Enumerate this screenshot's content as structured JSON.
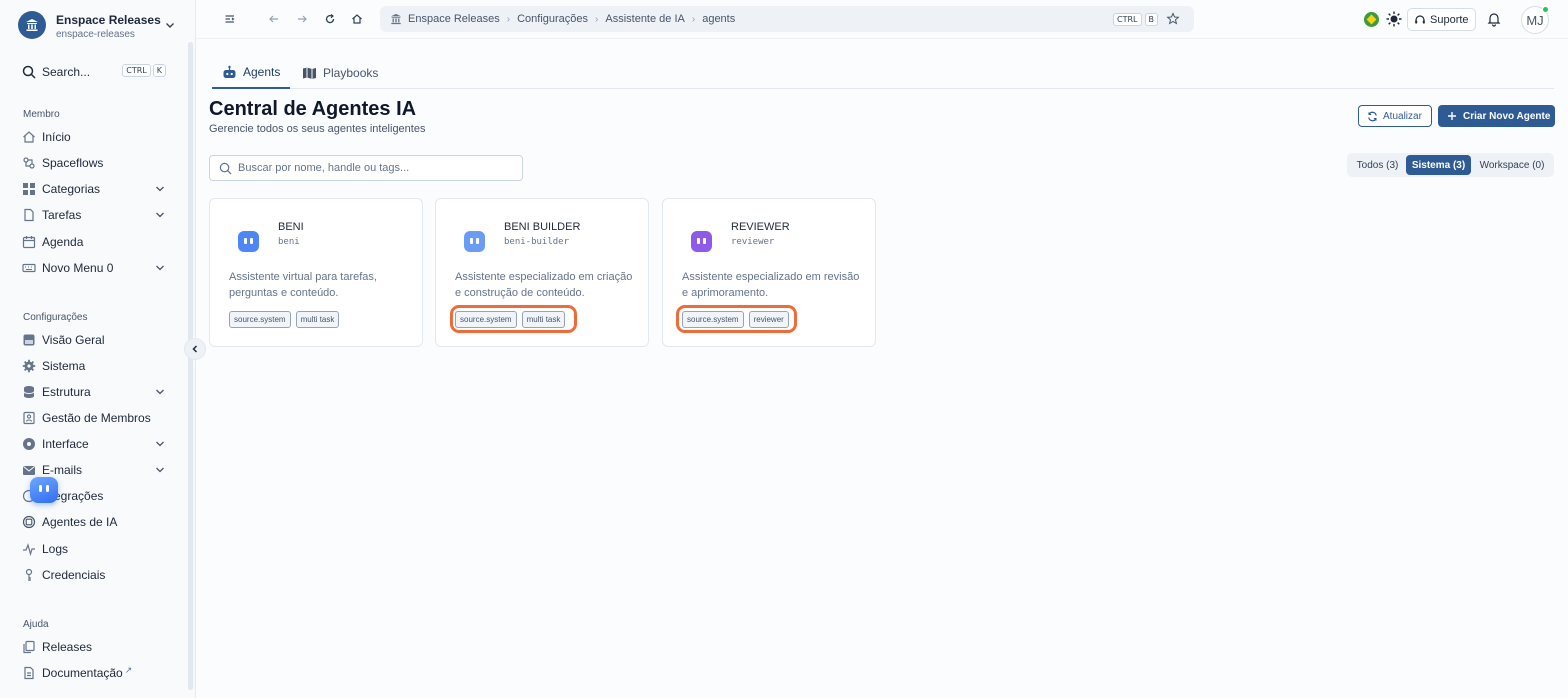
{
  "workspace": {
    "name": "Enspace Releases",
    "handle": "enspace-releases"
  },
  "search": {
    "label": "Search...",
    "kbd": [
      "CTRL",
      "K"
    ]
  },
  "sections": {
    "member": "Membro",
    "config": "Configurações",
    "help": "Ajuda"
  },
  "member_items": [
    {
      "label": "Início",
      "icon": "home-icon"
    },
    {
      "label": "Spaceflows",
      "icon": "flow-icon"
    },
    {
      "label": "Categorias",
      "icon": "grid-icon",
      "expandable": true
    },
    {
      "label": "Tarefas",
      "icon": "document-icon",
      "expandable": true
    },
    {
      "label": "Agenda",
      "icon": "calendar-icon"
    },
    {
      "label": "Novo Menu 0",
      "icon": "keyboard-icon",
      "expandable": true
    }
  ],
  "config_items": [
    {
      "label": "Visão Geral",
      "icon": "dashboard-icon"
    },
    {
      "label": "Sistema",
      "icon": "gear-icon"
    },
    {
      "label": "Estrutura",
      "icon": "database-icon",
      "expandable": true
    },
    {
      "label": "Gestão de Membros",
      "icon": "members-icon"
    },
    {
      "label": "Interface",
      "icon": "palette-icon",
      "expandable": true
    },
    {
      "label": "E-mails",
      "icon": "mail-icon",
      "expandable": true
    },
    {
      "label": "egrações",
      "icon": "integrations-icon"
    },
    {
      "label": "Agentes de IA",
      "icon": "chip-icon"
    },
    {
      "label": "Logs",
      "icon": "activity-icon"
    },
    {
      "label": "Credenciais",
      "icon": "key-icon"
    }
  ],
  "help_items": [
    {
      "label": "Releases",
      "icon": "copy-icon"
    },
    {
      "label": "Documentação",
      "icon": "doc-icon",
      "external": "↗"
    }
  ],
  "breadcrumb": [
    "Enspace Releases",
    "Configurações",
    "Assistente de IA",
    "agents"
  ],
  "breadcrumb_kbd": [
    "CTRL",
    "B"
  ],
  "topbar": {
    "support_label": "Suporte",
    "avatar_initials": "MJ"
  },
  "tabs": [
    {
      "label": "Agents",
      "active": true
    },
    {
      "label": "Playbooks",
      "active": false
    }
  ],
  "page": {
    "title": "Central de Agentes IA",
    "subtitle": "Gerencie todos os seus agentes inteligentes",
    "refresh_label": "Atualizar",
    "create_label": "Criar Novo Agente",
    "search_placeholder": "Buscar por nome, handle ou tags..."
  },
  "filters": [
    {
      "label": "Todos (3)",
      "active": false
    },
    {
      "label": "Sistema (3)",
      "active": true
    },
    {
      "label": "Workspace (0)",
      "active": false
    }
  ],
  "agents": [
    {
      "name": "BENI",
      "handle": "beni",
      "description": "Assistente virtual para tarefas, perguntas e conteúdo.",
      "tags": [
        "source.system",
        "multi task"
      ],
      "color": "#4f86f7"
    },
    {
      "name": "BENI BUILDER",
      "handle": "beni-builder",
      "description": "Assistente especializado em criação e construção de conteúdo.",
      "tags": [
        "source.system",
        "multi task"
      ],
      "color": "#6a9bf5"
    },
    {
      "name": "REVIEWER",
      "handle": "reviewer",
      "description": "Assistente especializado em revisão e aprimoramento.",
      "tags": [
        "source.system",
        "reviewer"
      ],
      "color": "#8e5ae8"
    }
  ],
  "colors": {
    "accent": "#2f5b95",
    "highlight": "#ef6c3a"
  }
}
